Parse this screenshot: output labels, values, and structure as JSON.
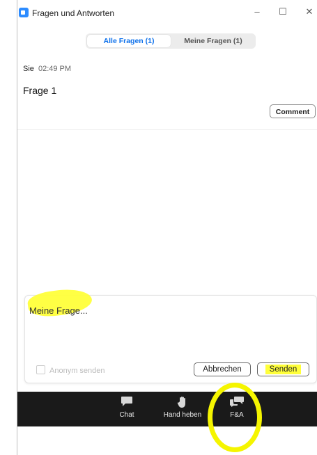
{
  "window": {
    "title": "Fragen und Antworten",
    "controls": {
      "minimize": "–",
      "maximize": "☐",
      "close": "✕"
    }
  },
  "tabs": [
    {
      "label": "Alle Fragen (1)",
      "active": true
    },
    {
      "label": "Meine Fragen (1)",
      "active": false
    }
  ],
  "question": {
    "author": "Sie",
    "time": "02:49 PM",
    "text": "Frage 1",
    "comment_label": "Comment"
  },
  "compose": {
    "placeholder": "Meine Frage...",
    "anonymous_label": "Anonym senden",
    "cancel_label": "Abbrechen",
    "send_label": "Senden"
  },
  "toolbar": {
    "items": [
      {
        "label": "Chat",
        "icon": "chat-icon"
      },
      {
        "label": "Hand heben",
        "icon": "hand-icon"
      },
      {
        "label": "F&A",
        "icon": "qa-icon"
      }
    ]
  },
  "colors": {
    "accent": "#0e71eb",
    "toolbar_bg": "#1a1a1a",
    "highlight": "#ffff3a"
  }
}
